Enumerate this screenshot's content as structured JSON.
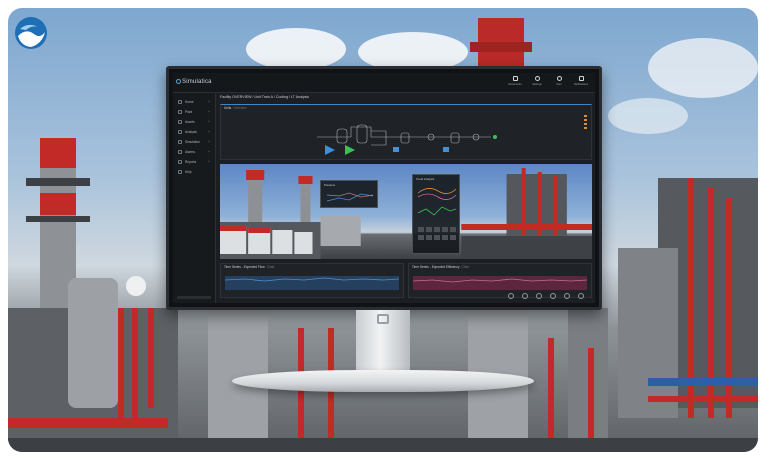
{
  "app": {
    "name": "Simulatica"
  },
  "topbar": {
    "icons": [
      {
        "name": "file-icon",
        "label": "Documents"
      },
      {
        "name": "gear-icon",
        "label": "Settings"
      },
      {
        "name": "user-icon",
        "label": "User"
      },
      {
        "name": "bell-icon",
        "label": "Notifications"
      }
    ]
  },
  "sidebar": {
    "items": [
      {
        "label": "Home",
        "count": "+"
      },
      {
        "label": "Plant",
        "count": "+"
      },
      {
        "label": "Assets",
        "count": "+"
      },
      {
        "label": "Analysis",
        "count": "+"
      },
      {
        "label": "Simulation",
        "count": "+"
      },
      {
        "label": "Alarms",
        "count": "+"
      },
      {
        "label": "Reports",
        "count": "+"
      },
      {
        "label": "Help",
        "count": ""
      }
    ]
  },
  "breadcrumb": "Facility OVERVIEW / Unit Train A / Cooling / LT Analysis",
  "diagram_panel": {
    "title": "Units",
    "subtitle": "Overview"
  },
  "video_overlays": [
    {
      "title": "Pressure"
    },
    {
      "title": "Trend Analysis"
    }
  ],
  "charts": [
    {
      "title": "Time Series - Expected Flow",
      "subtitle": "Chart"
    },
    {
      "title": "Time Series - Expected Efficiency",
      "subtitle": "Chart"
    }
  ],
  "colors": {
    "accent": "#3d86c8",
    "pipe_red": "#c62b2b",
    "series_blue": "#4a90d0",
    "series_pink": "#c86d8c"
  }
}
